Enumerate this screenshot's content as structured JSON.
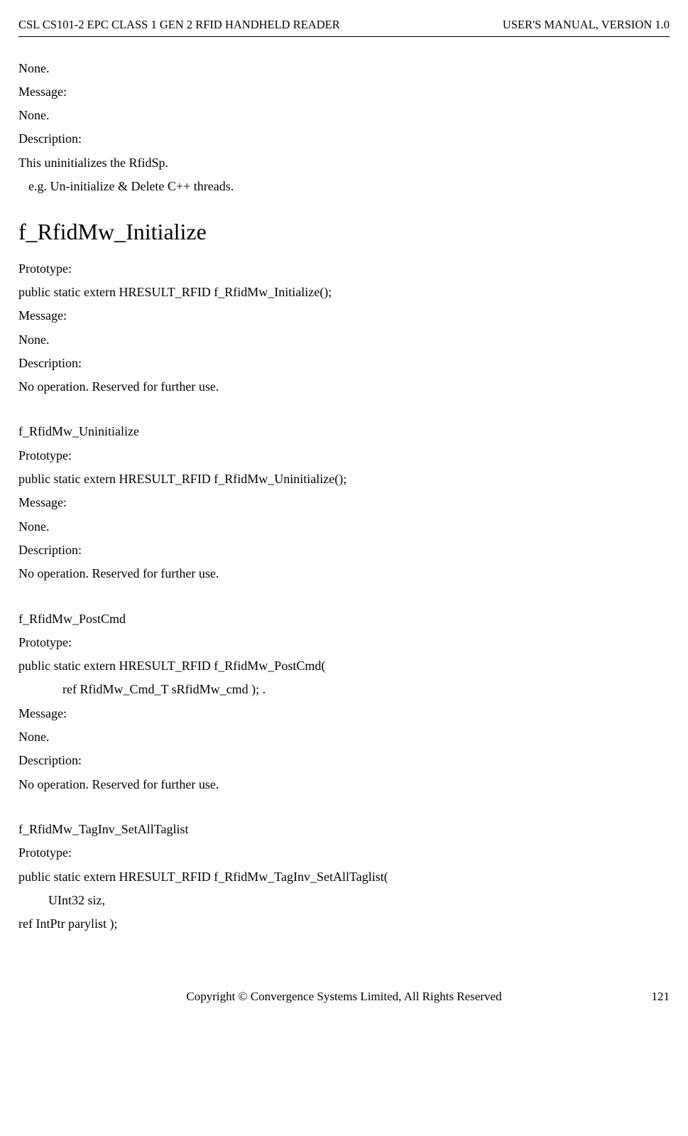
{
  "header": {
    "left": "CSL CS101-2 EPC CLASS 1 GEN 2 RFID HANDHELD READER",
    "right": "USER'S  MANUAL,  VERSION  1.0"
  },
  "section1": {
    "l1": "None.",
    "l2": "Message:",
    "l3": "None.",
    "l4": "Description:",
    "l5": "This uninitializes the RfidSp.",
    "l6": "e.g. Un-initialize & Delete C++ threads."
  },
  "func_title": "f_RfidMw_Initialize",
  "section2": {
    "l1": "Prototype:",
    "l2": "public static extern HRESULT_RFID f_RfidMw_Initialize();",
    "l3": "Message:",
    "l4": "None.",
    "l5": "Description:",
    "l6": "No operation. Reserved for further use."
  },
  "section3": {
    "l0": "f_RfidMw_Uninitialize",
    "l1": "Prototype:",
    "l2": "public static extern HRESULT_RFID f_RfidMw_Uninitialize();",
    "l3": "Message:",
    "l4": "None.",
    "l5": "Description:",
    "l6": "No operation. Reserved for further use."
  },
  "section4": {
    "l0": "f_RfidMw_PostCmd",
    "l1": "Prototype:",
    "l2": "public static extern HRESULT_RFID f_RfidMw_PostCmd(",
    "l3": "ref RfidMw_Cmd_T sRfidMw_cmd ); .",
    "l4": "Message:",
    "l5": "None.",
    "l6": "Description:",
    "l7": "No operation. Reserved for further use."
  },
  "section5": {
    "l0": "f_RfidMw_TagInv_SetAllTaglist",
    "l1": "Prototype:",
    "l2": "public static extern HRESULT_RFID f_RfidMw_TagInv_SetAllTaglist(",
    "l3": "UInt32    siz,",
    "l4": "ref IntPtr parylist );"
  },
  "footer": {
    "copyright": "Copyright © Convergence Systems Limited, All Rights Reserved",
    "page": "121"
  }
}
